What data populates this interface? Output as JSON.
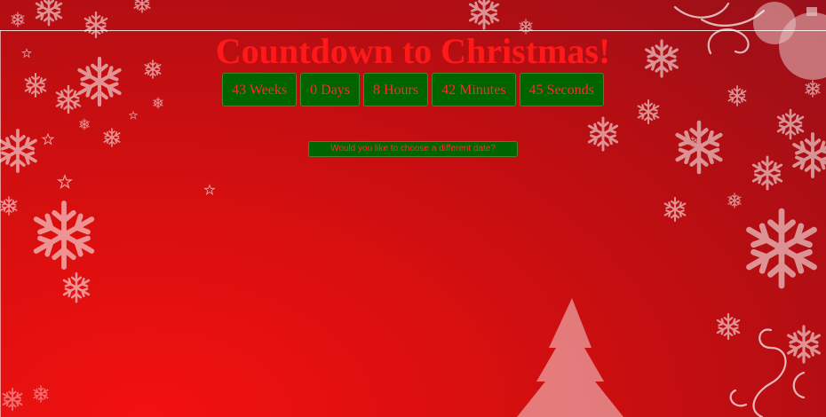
{
  "page": {
    "title": "Countdown to Christmas!",
    "countdown": [
      {
        "id": "weeks",
        "text": "43 Weeks"
      },
      {
        "id": "days",
        "text": "0 Days"
      },
      {
        "id": "hours",
        "text": "8 Hours"
      },
      {
        "id": "minutes",
        "text": "42 Minutes"
      },
      {
        "id": "seconds",
        "text": "45 Seconds"
      }
    ],
    "choose_date_label": "Would you like to choose a different date?"
  },
  "colors": {
    "title": "#ff1a1a",
    "box_background": "#006400",
    "box_text": "#ff2a2a",
    "background": "#d80f0f"
  },
  "decor": {
    "icons": [
      "snowflake-icon",
      "star-icon",
      "christmas-tree-icon",
      "ornament-icon",
      "swirl-icon"
    ]
  }
}
